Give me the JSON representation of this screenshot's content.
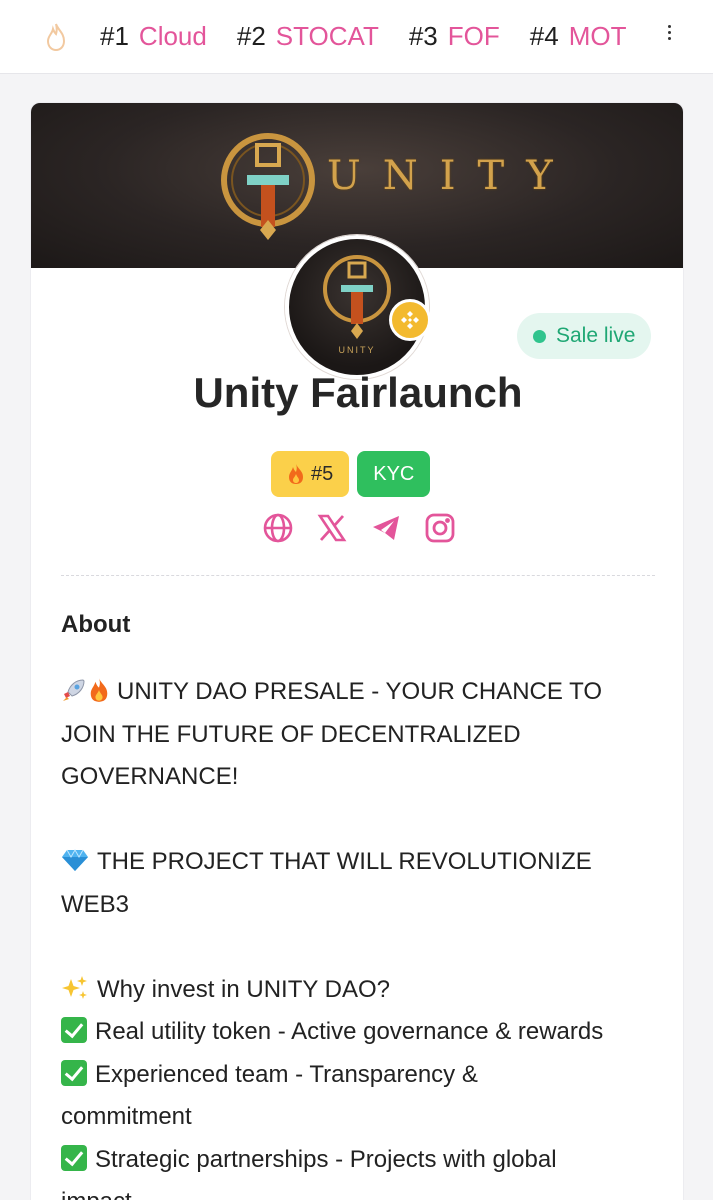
{
  "trending": {
    "items": [
      {
        "rank": "#1",
        "name": "Cloud"
      },
      {
        "rank": "#2",
        "name": "STOCAT"
      },
      {
        "rank": "#3",
        "name": "FOF"
      },
      {
        "rank": "#4",
        "name": "MOT"
      }
    ]
  },
  "banner": {
    "brand_text": "UNITY",
    "avatar_caption": "UNITY"
  },
  "project": {
    "title": "Unity Fairlaunch",
    "status": "Sale live",
    "rank_badge": "#5",
    "kyc_badge": "KYC"
  },
  "colors": {
    "accent_pink": "#e3559a",
    "sale_green": "#30c48d",
    "kyc_green": "#2fbf5e",
    "rank_yellow": "#fbd04a",
    "bnb_gold": "#f3ba2f"
  },
  "about": {
    "heading": "About",
    "lines": [
      "UNITY DAO PRESALE - YOUR CHANCE TO",
      "JOIN THE FUTURE OF DECENTRALIZED",
      "GOVERNANCE!",
      "",
      "THE PROJECT THAT WILL REVOLUTIONIZE",
      "WEB3",
      "",
      "Why invest in UNITY DAO?",
      "Real utility token - Active governance & rewards",
      "Experienced team - Transparency &",
      "commitment",
      "Strategic partnerships - Projects with global",
      "impact"
    ]
  }
}
